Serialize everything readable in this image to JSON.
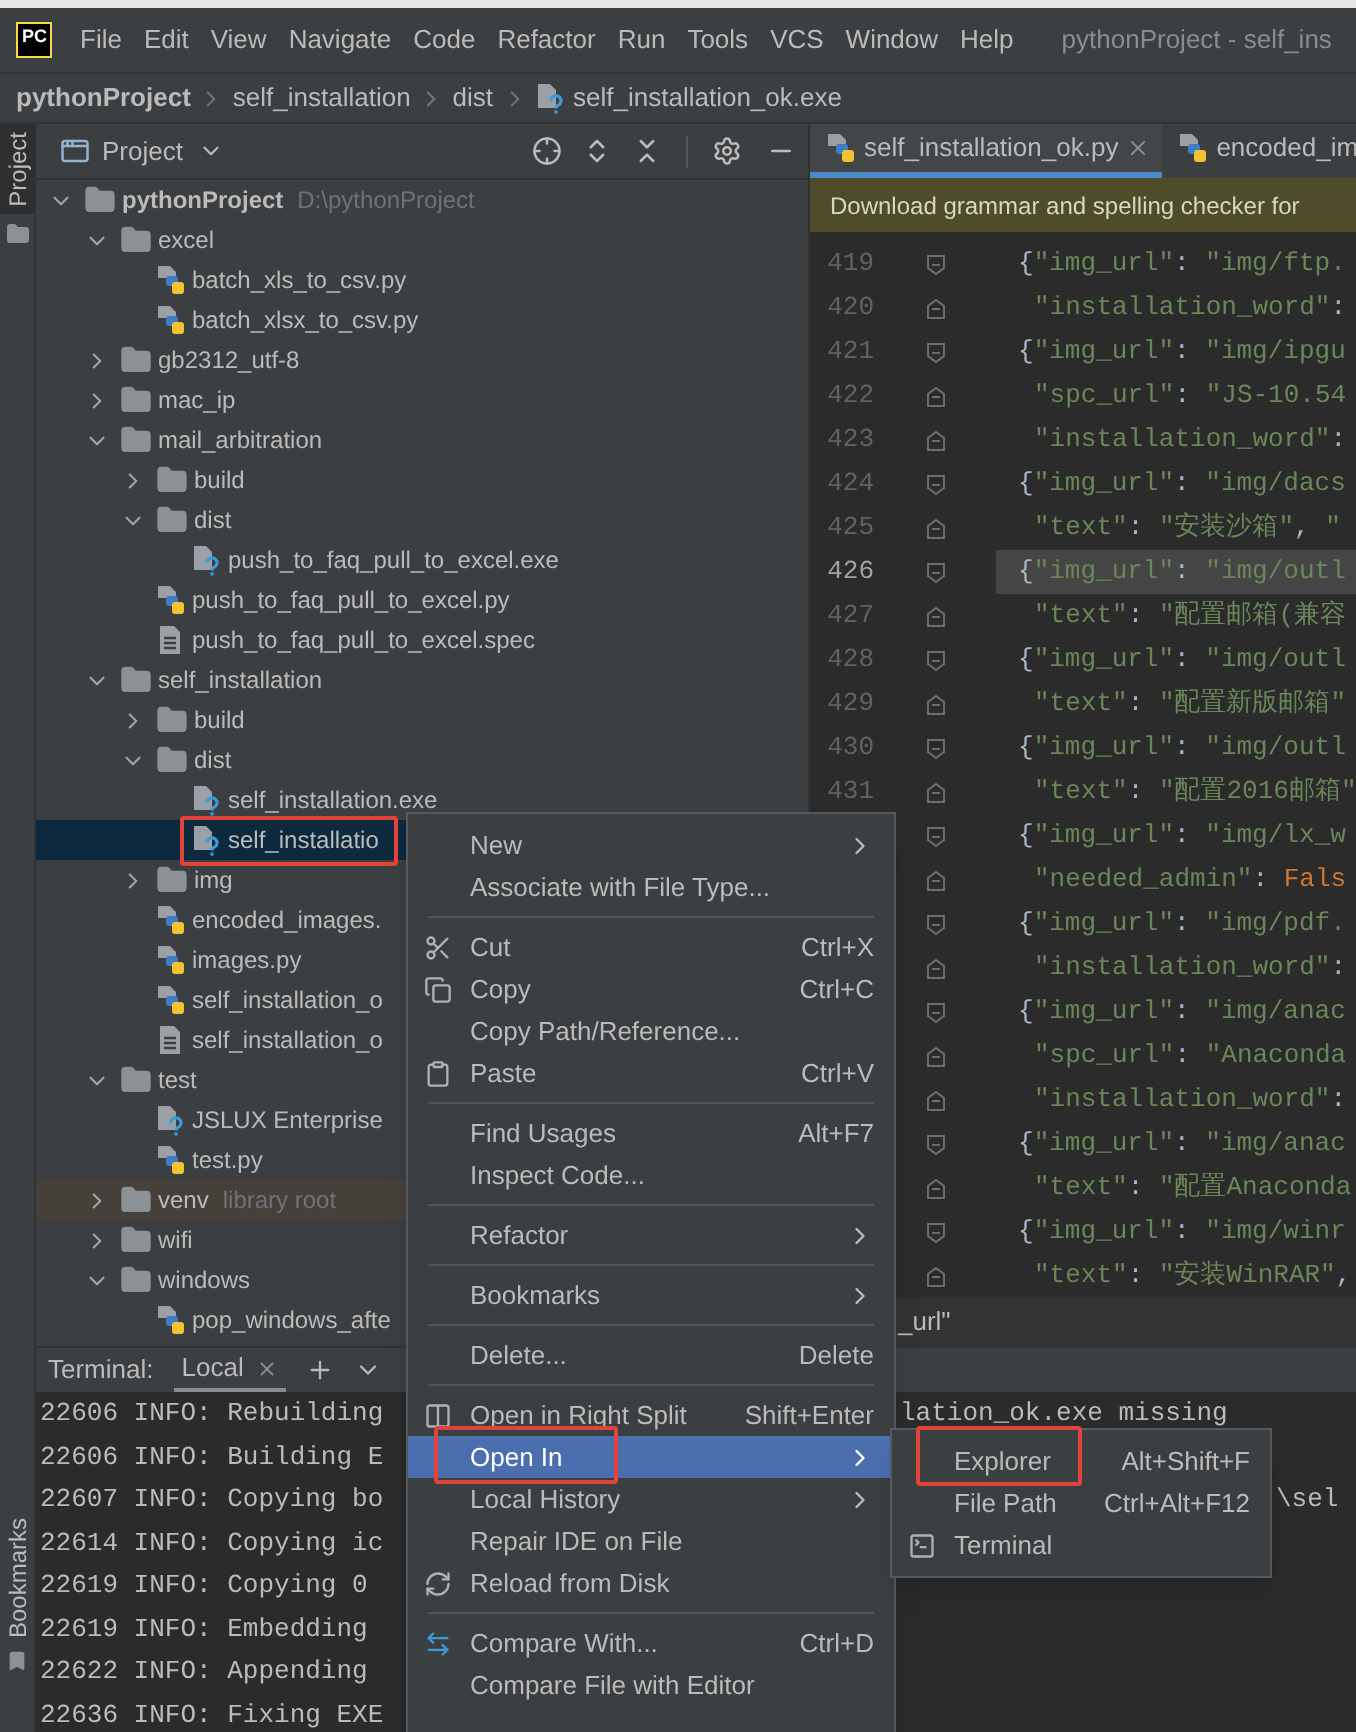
{
  "menu_bar": {
    "logo": "PC",
    "items": [
      "File",
      "Edit",
      "View",
      "Navigate",
      "Code",
      "Refactor",
      "Run",
      "Tools",
      "VCS",
      "Window",
      "Help"
    ],
    "title": "pythonProject - self_ins"
  },
  "breadcrumb": [
    {
      "label": "pythonProject",
      "kind": "project"
    },
    {
      "label": "self_installation",
      "kind": "folder"
    },
    {
      "label": "dist",
      "kind": "folder"
    },
    {
      "label": "self_installation_ok.exe",
      "kind": "file"
    }
  ],
  "side_strip": {
    "top_label": "Project",
    "top_selected": true,
    "bottom_label": "Bookmarks"
  },
  "project_panel": {
    "title": "Project",
    "tree": [
      {
        "label": "pythonProject",
        "hint": "D:\\pythonProject",
        "kind": "folder",
        "expanded": true,
        "selected": false,
        "children": [
          {
            "label": "excel",
            "kind": "folder",
            "expanded": true,
            "selected": false,
            "children": [
              {
                "label": "batch_xls_to_csv.py",
                "kind": "python",
                "selected": false
              },
              {
                "label": "batch_xlsx_to_csv.py",
                "kind": "python",
                "selected": false
              }
            ]
          },
          {
            "label": "gb2312_utf-8",
            "kind": "folder",
            "expanded": false,
            "selected": false
          },
          {
            "label": "mac_ip",
            "kind": "folder",
            "expanded": false,
            "selected": false
          },
          {
            "label": "mail_arbitration",
            "kind": "folder",
            "expanded": true,
            "selected": false,
            "children": [
              {
                "label": "build",
                "kind": "folder",
                "expanded": false,
                "selected": false
              },
              {
                "label": "dist",
                "kind": "folder",
                "expanded": true,
                "selected": false,
                "children": [
                  {
                    "label": "push_to_faq_pull_to_excel.exe",
                    "kind": "unknown",
                    "selected": false
                  }
                ]
              },
              {
                "label": "push_to_faq_pull_to_excel.py",
                "kind": "python",
                "selected": false
              },
              {
                "label": "push_to_faq_pull_to_excel.spec",
                "kind": "text",
                "selected": false
              }
            ]
          },
          {
            "label": "self_installation",
            "kind": "folder",
            "expanded": true,
            "selected": false,
            "children": [
              {
                "label": "build",
                "kind": "folder",
                "expanded": false,
                "selected": false
              },
              {
                "label": "dist",
                "kind": "folder",
                "expanded": true,
                "selected": false,
                "children": [
                  {
                    "label": "self_installation.exe",
                    "kind": "unknown",
                    "selected": false
                  },
                  {
                    "label": "self_installatio",
                    "kind": "unknown",
                    "selected": true,
                    "highlighted": true
                  }
                ]
              },
              {
                "label": "img",
                "kind": "folder",
                "expanded": false,
                "selected": false
              },
              {
                "label": "encoded_images.",
                "kind": "python",
                "selected": false
              },
              {
                "label": "images.py",
                "kind": "python",
                "selected": false
              },
              {
                "label": "self_installation_o",
                "kind": "python",
                "selected": false
              },
              {
                "label": "self_installation_o",
                "kind": "text",
                "selected": false
              }
            ]
          },
          {
            "label": "test",
            "kind": "folder",
            "expanded": true,
            "selected": false,
            "children": [
              {
                "label": "JSLUX Enterprise",
                "kind": "unknown",
                "selected": false
              },
              {
                "label": "test.py",
                "kind": "python",
                "selected": false
              }
            ]
          },
          {
            "label": "venv",
            "hint": "library root",
            "kind": "folder",
            "expanded": false,
            "selected": false,
            "library": true
          },
          {
            "label": "wifi",
            "kind": "folder",
            "expanded": false,
            "selected": false
          },
          {
            "label": "windows",
            "kind": "folder",
            "expanded": true,
            "selected": false,
            "children": [
              {
                "label": "pop_windows_afte",
                "kind": "python",
                "selected": false
              }
            ]
          }
        ]
      }
    ]
  },
  "editor": {
    "tabs": [
      {
        "label": "self_installation_ok.py",
        "selected": true,
        "closable": true
      },
      {
        "label": "encoded_im",
        "selected": false,
        "closable": false
      }
    ],
    "banner": "Download grammar and spelling checker for",
    "lines": [
      {
        "number": "419",
        "kind": "open",
        "code": "{\"img_url\": \"img/ftp.",
        "current": false
      },
      {
        "number": "420",
        "kind": "cont",
        "code": "\"installation_word\":",
        "current": false
      },
      {
        "number": "421",
        "kind": "open",
        "code": "{\"img_url\": \"img/ipgu",
        "current": false
      },
      {
        "number": "422",
        "kind": "cont",
        "code": "\"spc_url\": \"JS-10.54",
        "current": false
      },
      {
        "number": "423",
        "kind": "cont",
        "code": "\"installation_word\":",
        "current": false
      },
      {
        "number": "424",
        "kind": "open",
        "code": "{\"img_url\": \"img/dacs",
        "current": false
      },
      {
        "number": "425",
        "kind": "cont",
        "code": "\"text\": \"安装沙箱\", \"",
        "current": false
      },
      {
        "number": "426",
        "kind": "open",
        "code": "{\"img_url\": \"img/outl",
        "current": true
      },
      {
        "number": "427",
        "kind": "cont",
        "code": "\"text\": \"配置邮箱(兼容",
        "current": false
      },
      {
        "number": "428",
        "kind": "open",
        "code": "{\"img_url\": \"img/outl",
        "current": false
      },
      {
        "number": "429",
        "kind": "cont",
        "code": "\"text\": \"配置新版邮箱\"",
        "current": false
      },
      {
        "number": "430",
        "kind": "open",
        "code": "{\"img_url\": \"img/outl",
        "current": false
      },
      {
        "number": "431",
        "kind": "cont",
        "code": "\"text\": \"配置2016邮箱\"",
        "current": false
      },
      {
        "kind": "open",
        "code": "{\"img_url\": \"img/lx_w",
        "current": false
      },
      {
        "kind": "cont",
        "code": "\"needed_admin\": Fals",
        "current": false
      },
      {
        "kind": "open",
        "code": "{\"img_url\": \"img/pdf.",
        "current": false
      },
      {
        "kind": "cont",
        "code": "\"installation_word\":",
        "current": false
      },
      {
        "kind": "open",
        "code": "{\"img_url\": \"img/anac",
        "current": false
      },
      {
        "kind": "cont",
        "code": "\"spc_url\": \"Anaconda",
        "current": false
      },
      {
        "kind": "cont",
        "code": "\"installation_word\":",
        "current": false
      },
      {
        "kind": "open",
        "code": "{\"img_url\": \"img/anac",
        "current": false
      },
      {
        "kind": "cont",
        "code": "\"text\": \"配置Anaconda",
        "current": false
      },
      {
        "kind": "open",
        "code": "{\"img_url\": \"img/winr",
        "current": false
      },
      {
        "kind": "cont",
        "code": "\"text\": \"安装WinRAR\",",
        "current": false
      }
    ],
    "bottom_path": "_url\""
  },
  "terminal": {
    "title": "Terminal:",
    "tabs": [
      {
        "label": "Local",
        "selected": true
      }
    ],
    "lines": [
      {
        "text": "22606 INFO: Rebuilding",
        "middle": "lation_ok.exe missing"
      },
      {
        "text": "22606 INFO: Building E"
      },
      {
        "text": "22607 INFO: Copying bo",
        "right": "\\sel"
      },
      {
        "text": "22614 INFO: Copying ic"
      },
      {
        "text": "22619 INFO: Copying 0"
      },
      {
        "text": "22619 INFO: Embedding"
      },
      {
        "text": "22622 INFO: Appending"
      },
      {
        "text": "22636 INFO: Fixing EXE"
      }
    ]
  },
  "context_menu": {
    "items": [
      {
        "kind": "item",
        "label": "New",
        "submenu": true,
        "selected": false
      },
      {
        "kind": "item",
        "label": "Associate with File Type...",
        "selected": false
      },
      {
        "kind": "separator"
      },
      {
        "kind": "cut",
        "label": "Cut",
        "shortcut": "Ctrl+X",
        "selected": false
      },
      {
        "kind": "copy",
        "label": "Copy",
        "shortcut": "Ctrl+C",
        "selected": false
      },
      {
        "kind": "item",
        "label": "Copy Path/Reference...",
        "selected": false
      },
      {
        "kind": "paste",
        "label": "Paste",
        "shortcut": "Ctrl+V",
        "selected": false
      },
      {
        "kind": "separator"
      },
      {
        "kind": "item",
        "label": "Find Usages",
        "shortcut": "Alt+F7",
        "selected": false
      },
      {
        "kind": "item",
        "label": "Inspect Code...",
        "selected": false
      },
      {
        "kind": "separator"
      },
      {
        "kind": "item",
        "label": "Refactor",
        "submenu": true,
        "selected": false
      },
      {
        "kind": "separator"
      },
      {
        "kind": "item",
        "label": "Bookmarks",
        "submenu": true,
        "selected": false
      },
      {
        "kind": "separator"
      },
      {
        "kind": "item",
        "label": "Delete...",
        "shortcut": "Delete",
        "selected": false
      },
      {
        "kind": "separator"
      },
      {
        "kind": "split",
        "label": "Open in Right Split",
        "shortcut": "Shift+Enter",
        "selected": false
      },
      {
        "kind": "item",
        "label": "Open In",
        "submenu": true,
        "selected": true,
        "highlighted": true
      },
      {
        "kind": "item",
        "label": "Local History",
        "submenu": true,
        "selected": false
      },
      {
        "kind": "item",
        "label": "Repair IDE on File",
        "selected": false
      },
      {
        "kind": "reload",
        "label": "Reload from Disk",
        "selected": false
      },
      {
        "kind": "separator"
      },
      {
        "kind": "compare",
        "label": "Compare With...",
        "shortcut": "Ctrl+D",
        "selected": false
      },
      {
        "kind": "item",
        "label": "Compare File with Editor",
        "selected": false
      }
    ]
  },
  "submenu": {
    "items": [
      {
        "kind": "item",
        "label": "Explorer",
        "shortcut": "Alt+Shift+F",
        "selected": false,
        "highlighted": true
      },
      {
        "kind": "item",
        "label": "File Path",
        "shortcut": "Ctrl+Alt+F12",
        "selected": false
      },
      {
        "kind": "terminal",
        "label": "Terminal",
        "selected": false
      }
    ]
  }
}
